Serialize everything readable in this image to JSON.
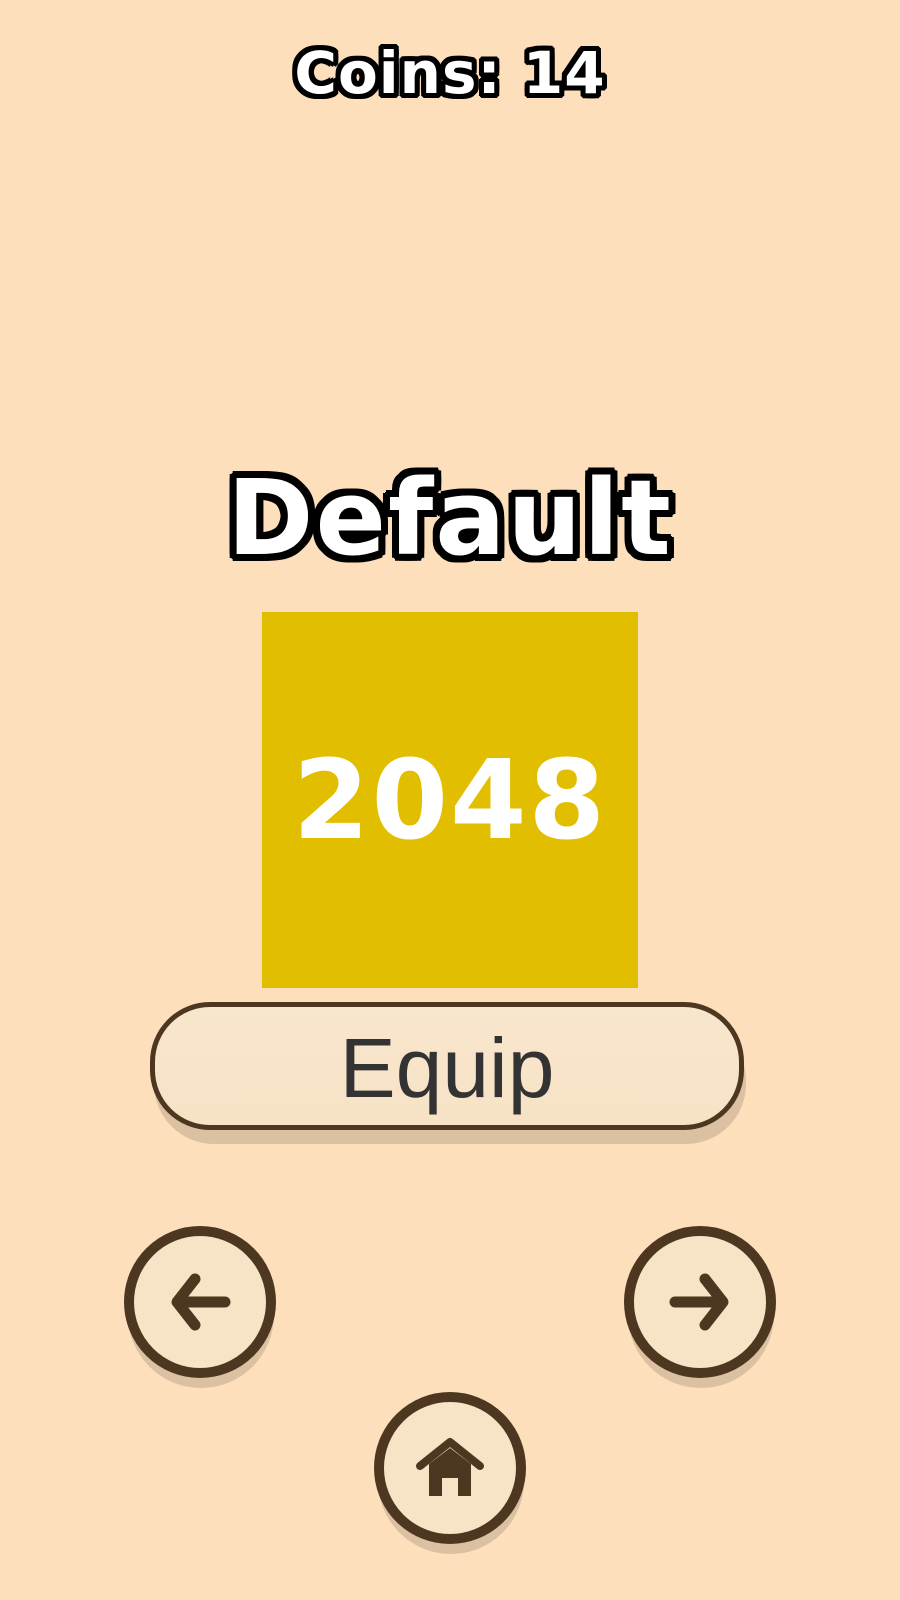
{
  "header": {
    "coins_text": "Coins: 14"
  },
  "skin": {
    "name": "Default",
    "tile_value": "2048",
    "tile_color": "#E1BE00",
    "tile_text_color": "#FFFFFF"
  },
  "actions": {
    "equip_label": "Equip"
  },
  "navigation": {
    "prev_icon": "arrow-left-icon",
    "next_icon": "arrow-right-icon",
    "home_icon": "home-icon"
  },
  "theme": {
    "background": "#FDDFBC",
    "button_fill": "#F7E3C6",
    "button_border": "#4E3720"
  }
}
